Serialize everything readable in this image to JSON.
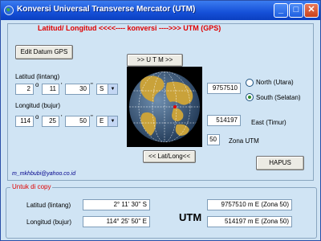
{
  "window": {
    "title": "Konversi Universal Transverse Mercator (UTM)",
    "buttons": {
      "minimize": "_",
      "maximize": "□",
      "close": "✕"
    }
  },
  "heading": "Latitud/ Longitud  <<<<----  konversi  ---->>>  UTM  (GPS)",
  "edit_gps_button": "Edit Datum GPS",
  "to_utm_button": ">> U T M >>",
  "to_latlong_button": "<< Lat/Long<<",
  "hapus_button": "HAPUS",
  "latitude": {
    "label": "Latitud (lintang)",
    "deg": "2",
    "min": "11",
    "sec": "30",
    "hemisphere": "S"
  },
  "longitude": {
    "label": "Longitud (bujur)",
    "deg": "114",
    "min": "25",
    "sec": "50",
    "hemisphere": "E"
  },
  "symbols": {
    "deg": "o",
    "min": "'",
    "sec": "\""
  },
  "north_value": "9757510",
  "east_value": "514197",
  "east_label": "East (Timur)",
  "zone_value": "50",
  "zone_label": "Zona UTM",
  "radio": {
    "north": "North (Utara)",
    "south": "South (Selatan)",
    "selected": "south"
  },
  "email": "m_mkhbubi@yahoo.co.id",
  "copy_group": {
    "title": "Untuk di copy",
    "lat_label": "Latitud (lintang)",
    "lat_value": "2° 11' 30'' S",
    "long_label": "Longitud (bujur)",
    "long_value": "114° 25' 50'' E",
    "utm_label": "UTM",
    "utm_north": "9757510 m E (Zona 50)",
    "utm_east": "514197 m E (Zona 50)"
  },
  "colors": {
    "heading": "#e00000",
    "group_title": "#e00000",
    "titlebar": "#1550d8",
    "window_bg": "#d0e4f4"
  }
}
